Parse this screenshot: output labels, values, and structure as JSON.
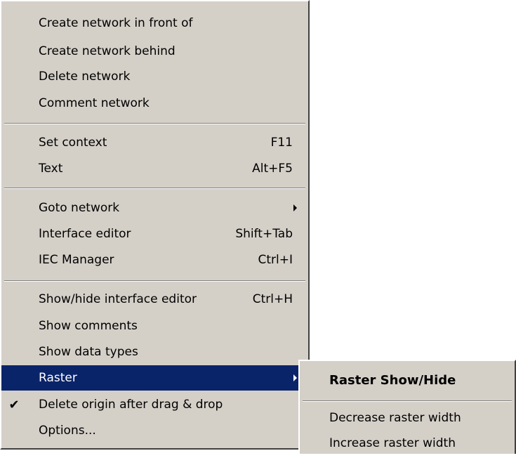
{
  "main_menu": {
    "items": [
      {
        "label": "Create network in front of",
        "shortcut": ""
      },
      {
        "label": "Create network behind",
        "shortcut": ""
      },
      {
        "label": "Delete network",
        "shortcut": ""
      },
      {
        "label": "Comment network",
        "shortcut": ""
      },
      {
        "label": "Set context",
        "shortcut": "F11"
      },
      {
        "label": "Text",
        "shortcut": "Alt+F5"
      },
      {
        "label": "Goto network",
        "shortcut": "",
        "submenu": true
      },
      {
        "label": "Interface editor",
        "shortcut": "Shift+Tab"
      },
      {
        "label": "IEC Manager",
        "shortcut": "Ctrl+I"
      },
      {
        "label": "Show/hide interface editor",
        "shortcut": "Ctrl+H"
      },
      {
        "label": "Show comments",
        "shortcut": ""
      },
      {
        "label": "Show data types",
        "shortcut": ""
      },
      {
        "label": "Raster",
        "shortcut": "",
        "submenu": true,
        "highlighted": true
      },
      {
        "label": "Delete origin after drag & drop",
        "shortcut": "",
        "checked": true
      },
      {
        "label": "Options...",
        "shortcut": ""
      }
    ]
  },
  "sub_menu": {
    "items": [
      {
        "label": "Raster Show/Hide",
        "default": true
      },
      {
        "label": "Decrease raster width"
      },
      {
        "label": "Increase raster width"
      }
    ]
  },
  "colors": {
    "menu_face": "#d4d0c8",
    "highlight": "#0a246a"
  },
  "icons": {
    "submenu": "submenu-arrow-icon",
    "check": "checkmark-icon"
  }
}
